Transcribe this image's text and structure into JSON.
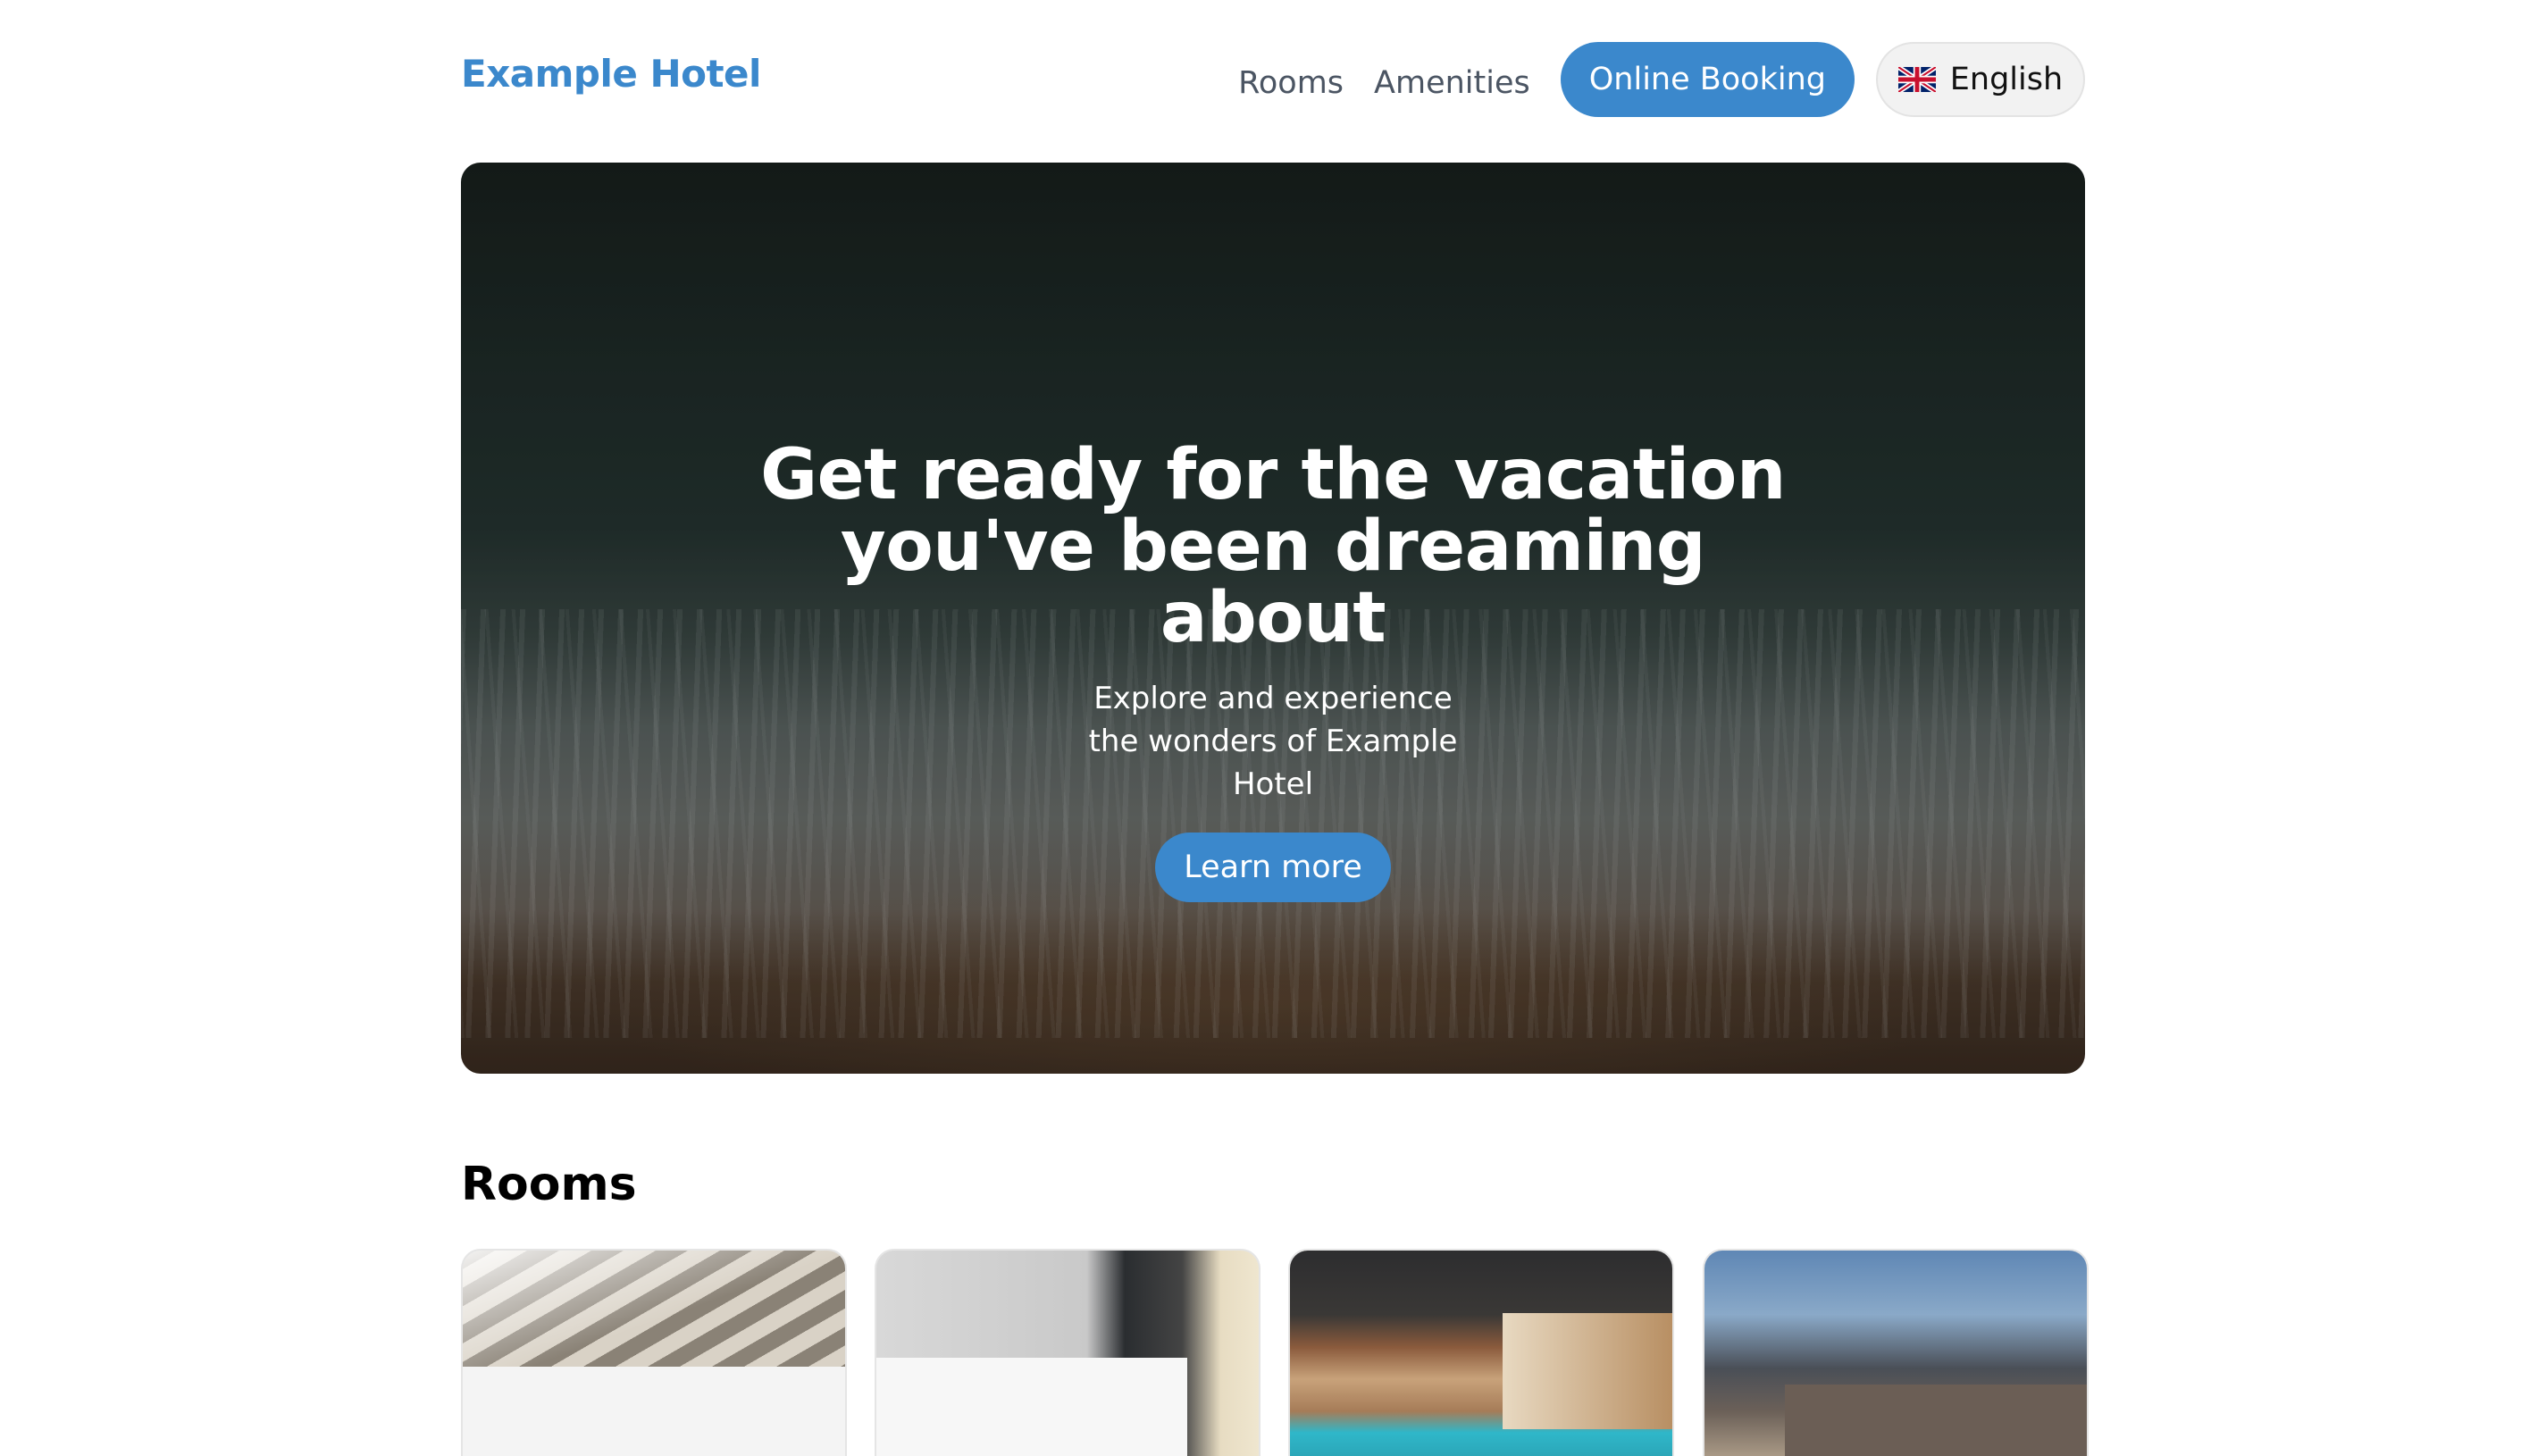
{
  "header": {
    "brand": "Example Hotel",
    "nav": {
      "rooms": "Rooms",
      "amenities": "Amenities"
    },
    "booking_button": "Online Booking",
    "language": {
      "label": "English",
      "flag_icon": "uk-flag-icon"
    }
  },
  "hero": {
    "title": "Get ready for the vacation you've been dreaming about",
    "subtitle": "Explore and experience the wonders of Example Hotel",
    "cta": "Learn more"
  },
  "rooms": {
    "title": "Rooms",
    "cards": [
      {
        "image": "bed-pillow-photo"
      },
      {
        "image": "white-bedroom-photo"
      },
      {
        "image": "indoor-pool-photo"
      },
      {
        "image": "city-view-bedroom-photo"
      }
    ]
  },
  "colors": {
    "accent": "#3b88cc",
    "nav_text": "#4b5563"
  }
}
